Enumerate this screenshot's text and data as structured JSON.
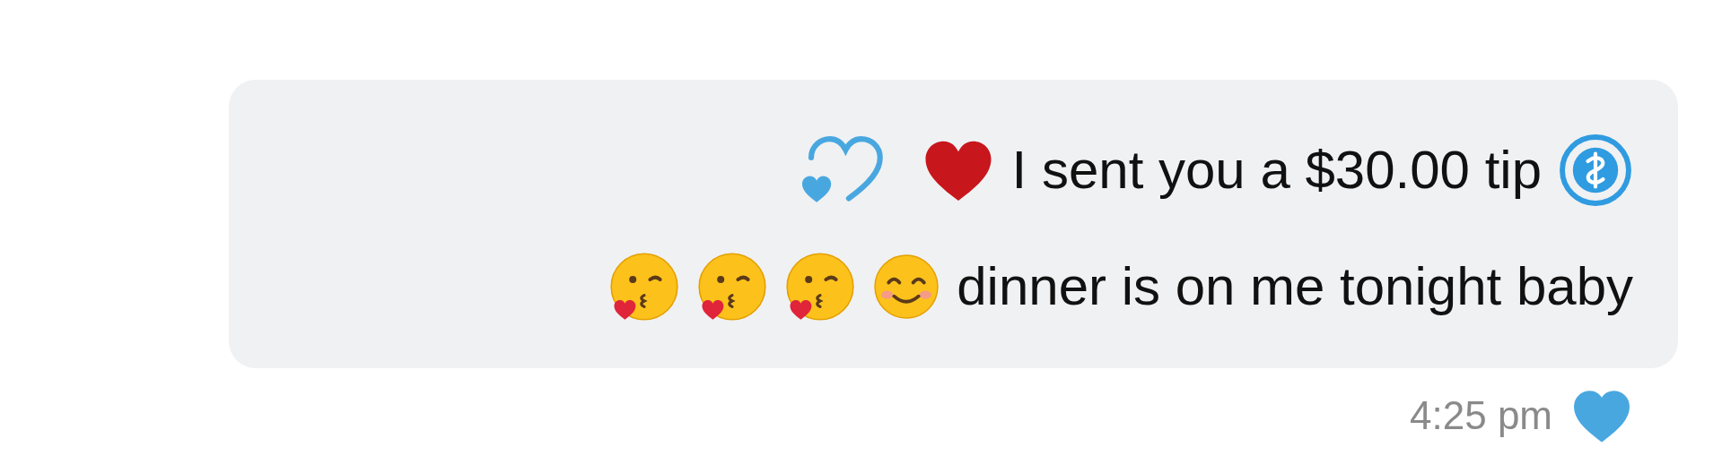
{
  "message": {
    "lines": [
      {
        "kind": "tip",
        "text": "I sent you a $30.00 tip"
      },
      {
        "kind": "text",
        "text": "dinner is on me tonight baby"
      }
    ],
    "liked": true,
    "time": "4:25 pm"
  }
}
